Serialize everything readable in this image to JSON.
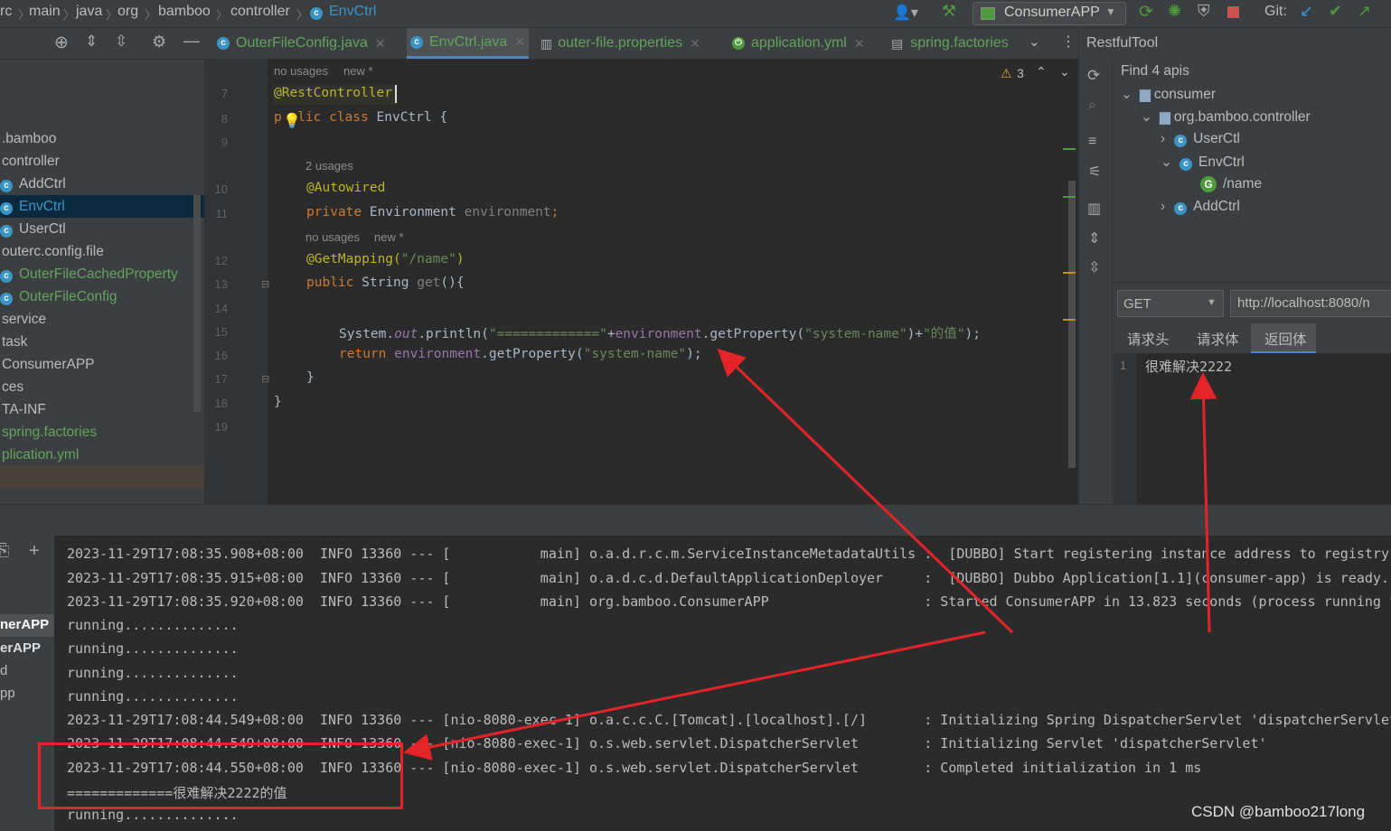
{
  "breadcrumb": [
    "rc",
    "main",
    "java",
    "org",
    "bamboo",
    "controller",
    "EnvCtrl"
  ],
  "toolbar": {
    "run_config": "ConsumerAPP",
    "git_label": "Git:"
  },
  "tabs": [
    {
      "label": "OuterFileConfig.java"
    },
    {
      "label": "EnvCtrl.java"
    },
    {
      "label": "outer-file.properties"
    },
    {
      "label": "application.yml"
    },
    {
      "label": "spring.factories"
    }
  ],
  "tree": [
    ".bamboo",
    "controller",
    "AddCtrl",
    "EnvCtrl",
    "UserCtl",
    "outerc.config.file",
    "OuterFileCachedProperty",
    "OuterFileConfig",
    "service",
    "task",
    "ConsumerAPP",
    "ces",
    "TA-INF",
    "spring.factories",
    "plication.yml"
  ],
  "editor": {
    "warnings": "3",
    "line_numbers": [
      "7",
      "8",
      "9",
      "10",
      "11",
      "12",
      "13",
      "14",
      "15",
      "16",
      "17",
      "18",
      "19"
    ],
    "hints": {
      "h1a": "no usages",
      "h1b": "new *",
      "h2": "2 usages",
      "h3a": "no usages",
      "h3b": "new *"
    },
    "code": {
      "l7": "@RestController",
      "l8_kw": "p  lic class ",
      "l8_name": "EnvCtrl {",
      "l10": "@Autowired",
      "l11_kw": "private ",
      "l11_type": "Environment ",
      "l11_field": "environment",
      "l11_semi": ";",
      "l12_ann": "@GetMapping(",
      "l12_str": "\"/name\"",
      "l12_end": ")",
      "l13_kw": "public ",
      "l13_type": "String ",
      "l13_meth": "get",
      "l13_end": "(){",
      "l15_a": "System.",
      "l15_out": "out",
      "l15_b": ".println(",
      "l15_s1": "\"=============\"",
      "l15_c": "+",
      "l15_env": "environment",
      "l15_d": ".getProperty(",
      "l15_s2": "\"system-name\"",
      "l15_e": ")+",
      "l15_s3": "\"的值\"",
      "l15_f": ");",
      "l16_kw": "return ",
      "l16_env": "environment",
      "l16_a": ".getProperty(",
      "l16_s": "\"system-name\"",
      "l16_b": ");",
      "l17": "}",
      "l18": "}"
    }
  },
  "restful": {
    "title": "RestfulTool",
    "find": "Find 4 apis",
    "tree": [
      "consumer",
      "org.bamboo.controller",
      "UserCtl",
      "EnvCtrl",
      "/name",
      "AddCtrl"
    ],
    "method": "GET",
    "url": "http://localhost:8080/n",
    "tabs": [
      "请求头",
      "请求体",
      "返回体"
    ],
    "response_line": "1",
    "response": "很难解决2222"
  },
  "console": {
    "side": [
      "nerAPP",
      "erAPP",
      "d",
      "pp"
    ],
    "lines": [
      "2023-11-29T17:08:35.908+08:00  INFO 13360 --- [           main] o.a.d.r.c.m.ServiceInstanceMetadataUtils :  [DUBBO] Start registering instance address to registry.",
      "2023-11-29T17:08:35.915+08:00  INFO 13360 --- [           main] o.a.d.c.d.DefaultApplicationDeployer     :  [DUBBO] Dubbo Application[1.1](consumer-app) is ready.,",
      "2023-11-29T17:08:35.920+08:00  INFO 13360 --- [           main] org.bamboo.ConsumerAPP                   : Started ConsumerAPP in 13.823 seconds (process running f",
      "running..............",
      "running..............",
      "running..............",
      "running..............",
      "2023-11-29T17:08:44.549+08:00  INFO 13360 --- [nio-8080-exec-1] o.a.c.c.C.[Tomcat].[localhost].[/]       : Initializing Spring DispatcherServlet 'dispatcherServlet'",
      "2023-11-29T17:08:44.549+08:00  INFO 13360 --- [nio-8080-exec-1] o.s.web.servlet.DispatcherServlet        : Initializing Servlet 'dispatcherServlet'",
      "2023-11-29T17:08:44.550+08:00  INFO 13360 --- [nio-8080-exec-1] o.s.web.servlet.DispatcherServlet        : Completed initialization in 1 ms",
      "=============很难解决2222的值",
      "running.............."
    ]
  },
  "watermark": "CSDN @bamboo217long"
}
